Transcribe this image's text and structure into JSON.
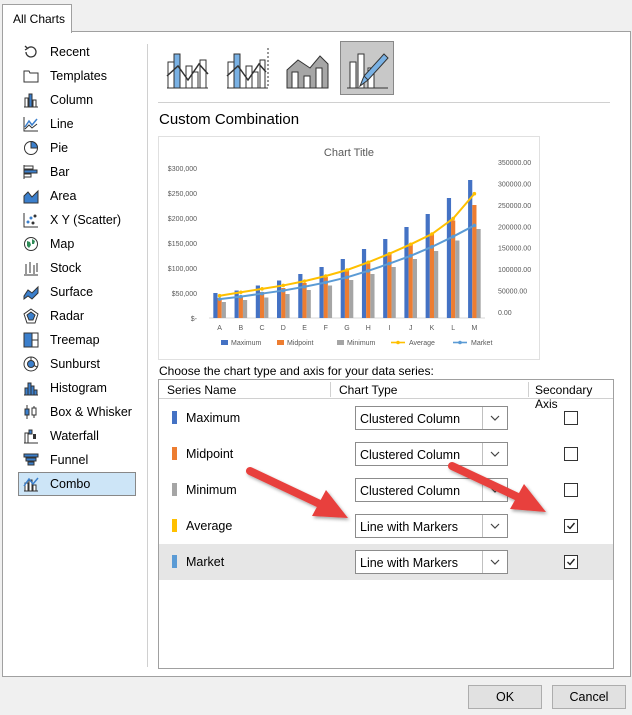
{
  "tab": {
    "label": "All Charts"
  },
  "nav": {
    "items": [
      {
        "label": "Recent",
        "icon": "recent-icon"
      },
      {
        "label": "Templates",
        "icon": "templates-icon"
      },
      {
        "label": "Column",
        "icon": "column-chart-icon"
      },
      {
        "label": "Line",
        "icon": "line-chart-icon"
      },
      {
        "label": "Pie",
        "icon": "pie-chart-icon"
      },
      {
        "label": "Bar",
        "icon": "bar-chart-icon"
      },
      {
        "label": "Area",
        "icon": "area-chart-icon"
      },
      {
        "label": "X Y (Scatter)",
        "icon": "scatter-chart-icon"
      },
      {
        "label": "Map",
        "icon": "map-chart-icon"
      },
      {
        "label": "Stock",
        "icon": "stock-chart-icon"
      },
      {
        "label": "Surface",
        "icon": "surface-chart-icon"
      },
      {
        "label": "Radar",
        "icon": "radar-chart-icon"
      },
      {
        "label": "Treemap",
        "icon": "treemap-chart-icon"
      },
      {
        "label": "Sunburst",
        "icon": "sunburst-chart-icon"
      },
      {
        "label": "Histogram",
        "icon": "histogram-chart-icon"
      },
      {
        "label": "Box & Whisker",
        "icon": "box-whisker-chart-icon"
      },
      {
        "label": "Waterfall",
        "icon": "waterfall-chart-icon"
      },
      {
        "label": "Funnel",
        "icon": "funnel-chart-icon"
      },
      {
        "label": "Combo",
        "icon": "combo-chart-icon"
      }
    ],
    "selected": "Combo"
  },
  "heading": "Custom Combination",
  "preview": {
    "title": "Chart Title",
    "categories": [
      "A",
      "B",
      "C",
      "D",
      "E",
      "F",
      "G",
      "H",
      "I",
      "J",
      "K",
      "L",
      "M"
    ],
    "left_ticks": [
      "$300,000",
      "$250,000",
      "$200,000",
      "$150,000",
      "$100,000",
      "$50,000",
      "$-"
    ],
    "right_ticks": [
      "350000.00",
      "300000.00",
      "250000.00",
      "200000.00",
      "150000.00",
      "100000.00",
      "50000.00",
      "0.00"
    ],
    "left_max": 300000,
    "right_max": 350000,
    "maximum": [
      50000,
      55000,
      65000,
      75000,
      88000,
      102000,
      118000,
      138000,
      158000,
      182000,
      208000,
      240000,
      276000
    ],
    "midpoint": [
      40000,
      45000,
      52000,
      60000,
      70000,
      82000,
      95000,
      110000,
      128000,
      148000,
      168000,
      195000,
      226000
    ],
    "minimum": [
      32000,
      36000,
      41000,
      48000,
      56000,
      65000,
      76000,
      88000,
      102000,
      118000,
      134000,
      155000,
      178000
    ],
    "average": [
      52000,
      60000,
      68000,
      76000,
      86000,
      98000,
      112000,
      130000,
      150000,
      172000,
      196000,
      232000,
      290000
    ],
    "market": [
      44000,
      50000,
      57000,
      64000,
      73000,
      83000,
      95000,
      110000,
      127000,
      145000,
      166000,
      190000,
      216000
    ],
    "legend": [
      "Maximum",
      "Midpoint",
      "Minimum",
      "Average",
      "Market"
    ]
  },
  "colors": {
    "maximum": "#4472c4",
    "midpoint": "#ed7d31",
    "minimum": "#a5a5a5",
    "average": "#ffc000",
    "market": "#5b9bd5",
    "arrow": "#e8403c"
  },
  "choose_label": "Choose the chart type and axis for your data series:",
  "grid": {
    "headers": {
      "name": "Series Name",
      "type": "Chart Type",
      "axis": "Secondary Axis"
    },
    "rows": [
      {
        "name": "Maximum",
        "type": "Clustered Column",
        "secondary": false
      },
      {
        "name": "Midpoint",
        "type": "Clustered Column",
        "secondary": false
      },
      {
        "name": "Minimum",
        "type": "Clustered Column",
        "secondary": false
      },
      {
        "name": "Average",
        "type": "Line with Markers",
        "secondary": true
      },
      {
        "name": "Market",
        "type": "Line with Markers",
        "secondary": true
      }
    ]
  },
  "buttons": {
    "ok": "OK",
    "cancel": "Cancel"
  }
}
